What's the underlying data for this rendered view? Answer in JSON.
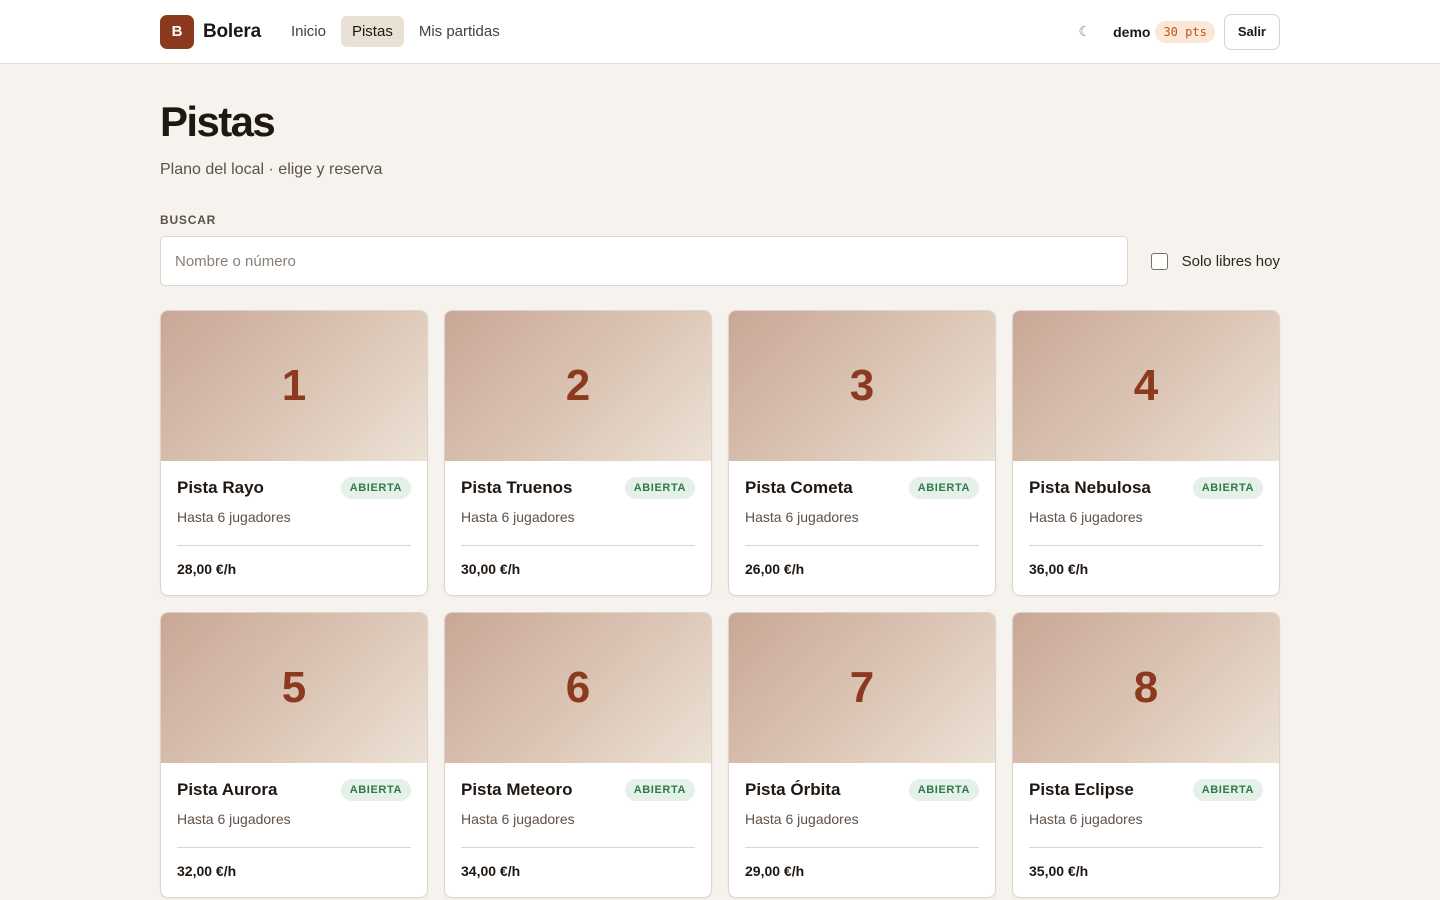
{
  "header": {
    "logo_letter": "B",
    "brand": "Bolera",
    "nav": [
      {
        "label": "Inicio"
      },
      {
        "label": "Pistas"
      },
      {
        "label": "Mis partidas"
      }
    ],
    "theme_toggle": "☾",
    "username": "demo",
    "points": "30 pts",
    "logout_label": "Salir"
  },
  "page": {
    "title": "Pistas",
    "subtitle": "Plano del local · elige y reserva"
  },
  "search": {
    "label": "BUSCAR",
    "placeholder": "Nombre o número",
    "value": "",
    "filter_label": "Solo libres hoy",
    "filter_checked": false
  },
  "lanes": [
    {
      "number": "1",
      "name": "Pista Rayo",
      "status": "ABIERTA",
      "capacity": "Hasta 6 jugadores",
      "price": "28,00 €/h"
    },
    {
      "number": "2",
      "name": "Pista Truenos",
      "status": "ABIERTA",
      "capacity": "Hasta 6 jugadores",
      "price": "30,00 €/h"
    },
    {
      "number": "3",
      "name": "Pista Cometa",
      "status": "ABIERTA",
      "capacity": "Hasta 6 jugadores",
      "price": "26,00 €/h"
    },
    {
      "number": "4",
      "name": "Pista Nebulosa",
      "status": "ABIERTA",
      "capacity": "Hasta 6 jugadores",
      "price": "36,00 €/h"
    },
    {
      "number": "5",
      "name": "Pista Aurora",
      "status": "ABIERTA",
      "capacity": "Hasta 6 jugadores",
      "price": "32,00 €/h"
    },
    {
      "number": "6",
      "name": "Pista Meteoro",
      "status": "ABIERTA",
      "capacity": "Hasta 6 jugadores",
      "price": "34,00 €/h"
    },
    {
      "number": "7",
      "name": "Pista Órbita",
      "status": "ABIERTA",
      "capacity": "Hasta 6 jugadores",
      "price": "29,00 €/h"
    },
    {
      "number": "8",
      "name": "Pista Eclipse",
      "status": "ABIERTA",
      "capacity": "Hasta 6 jugadores",
      "price": "35,00 €/h"
    }
  ],
  "colors": {
    "accent": "#8c3a1f",
    "background": "#f6f3ee",
    "badge_open": "#2f7a4a",
    "points": "#c2541f"
  }
}
